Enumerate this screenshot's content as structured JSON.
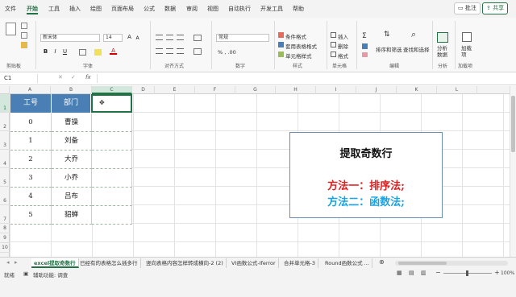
{
  "menu": {
    "items": [
      "文件",
      "开始",
      "工具",
      "插入",
      "绘图",
      "页面布局",
      "公式",
      "数据",
      "审阅",
      "视图",
      "自动执行",
      "开发工具",
      "帮助"
    ],
    "active": "开始",
    "comment_button": "批注",
    "share_button": "共享"
  },
  "ribbon": {
    "clipboard": {
      "label": "剪贴板"
    },
    "font": {
      "label": "字体",
      "font_name": "新宋体",
      "font_size": "14",
      "bold": "B",
      "italic": "I",
      "underline": "U"
    },
    "alignment": {
      "label": "对齐方式"
    },
    "number": {
      "label": "数字",
      "format": "常规"
    },
    "styles": {
      "label": "样式",
      "conditional": "条件格式",
      "table_format": "套用表格格式",
      "cell_styles": "单元格样式"
    },
    "cells": {
      "label": "单元格",
      "insert": "插入",
      "delete": "删除",
      "format": "格式"
    },
    "editing": {
      "label": "编辑",
      "sort_filter": "排序和筛选",
      "find_select": "查找和选择"
    },
    "analysis": {
      "label": "分析",
      "analyze_data": "分析数据"
    },
    "addins": {
      "label": "加载项",
      "addins": "加载项"
    }
  },
  "formula_bar": {
    "name_box": "C1",
    "fx": "fx",
    "value": ""
  },
  "columns": [
    "A",
    "B",
    "C",
    "D",
    "E",
    "F",
    "G",
    "H",
    "I",
    "J",
    "K",
    "L"
  ],
  "rows": [
    "1",
    "2",
    "3",
    "4",
    "5",
    "6",
    "7",
    "8",
    "9",
    "10"
  ],
  "table": {
    "headers": [
      "工号",
      "部门"
    ],
    "rows": [
      [
        "0",
        "曹操"
      ],
      [
        "1",
        "刘备"
      ],
      [
        "2",
        "大乔"
      ],
      [
        "3",
        "小乔"
      ],
      [
        "4",
        "吕布"
      ],
      [
        "5",
        "貂蝉"
      ]
    ]
  },
  "textbox": {
    "title": "提取奇数行",
    "line1": "方法一：排序法;",
    "line2": "方法二：函数法;",
    "line1_color": "#e02020",
    "line2_color": "#1aa3e0"
  },
  "sheet_tabs": [
    "excel提取奇数行",
    "已经有的表格怎么插多行",
    "竖向表格内容怎样转成横向-2 (2)",
    "VI函数公式-Iferror",
    "合并单元格-3",
    "Round函数公式 ..."
  ],
  "active_tab": "excel提取奇数行",
  "status": {
    "ready": "就绪",
    "accessibility": "辅助功能: 调查",
    "zoom": "100%"
  },
  "colors": {
    "accent": "#217346",
    "header_fill": "#4a7fb5"
  }
}
